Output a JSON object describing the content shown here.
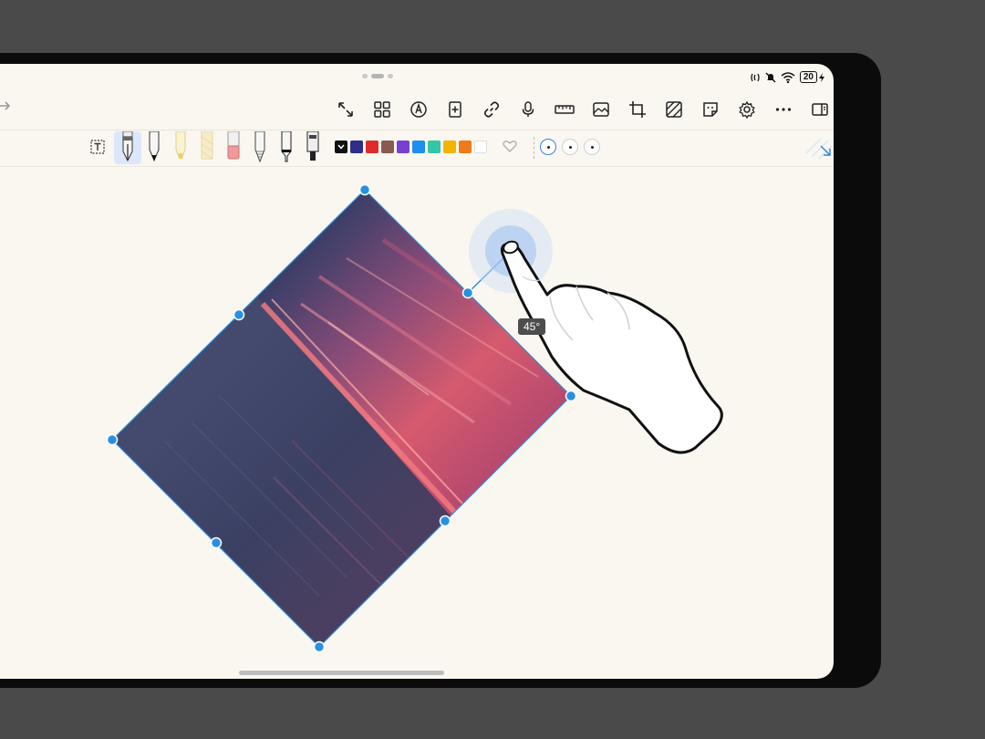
{
  "status_bar": {
    "battery_level": "20"
  },
  "toolbar": {
    "icons": [
      "fullscreen-icon",
      "grid-icon",
      "pen-circle-icon",
      "add-page-icon",
      "link-icon",
      "microphone-icon",
      "ruler-icon",
      "image-icon",
      "crop-icon",
      "texture-icon",
      "sticker-icon",
      "settings-icon",
      "more-icon",
      "sidebar-icon"
    ]
  },
  "pen_bar": {
    "tools": [
      "fountain-pen",
      "ballpoint-pen",
      "highlighter",
      "textured-highlighter",
      "eraser",
      "pencil",
      "fineliner",
      "marker"
    ],
    "selected_tool": "fountain-pen",
    "colors": [
      "#111111",
      "#2d2f8a",
      "#e02b2b",
      "#8a5a4f",
      "#7a3fd0",
      "#1e8ef0",
      "#34c6a8",
      "#f5b400",
      "#f07a1a",
      "#ffffff"
    ],
    "selected_size": 0
  },
  "canvas": {
    "rotation_label": "45°",
    "image_description_colors": {
      "sky_dark": "#3a3f66",
      "sky_glow": "#d8566c",
      "horizon": "#e8707a",
      "water": "#3e4566"
    },
    "selection_color": "#2a8fe0"
  }
}
